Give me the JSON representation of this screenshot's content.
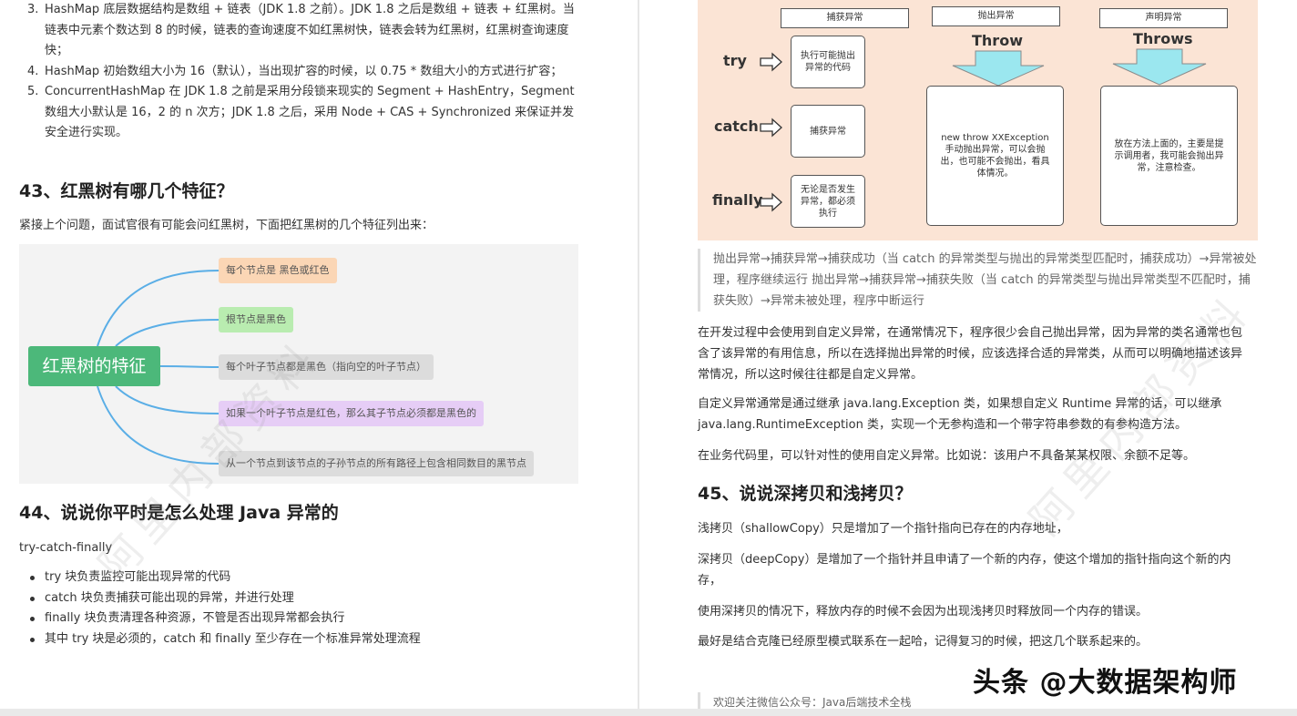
{
  "left": {
    "intro_list": [
      {
        "num": "3.",
        "text": "HashMap 底层数据结构是数组 + 链表（JDK 1.8 之前）。JDK 1.8 之后是数组 + 链表 + 红黑树。当链表中元素个数达到 8 的时候，链表的查询速度不如红黑树快，链表会转为红黑树，红黑树查询速度快；"
      },
      {
        "num": "4.",
        "text": "HashMap 初始数组大小为 16（默认），当出现扩容的时候，以 0.75 * 数组大小的方式进行扩容；"
      },
      {
        "num": "5.",
        "text": "ConcurrentHashMap 在 JDK 1.8 之前是采用分段锁来现实的 Segment + HashEntry，Segment 数组大小默认是 16，2 的 n 次方；JDK 1.8 之后，采用 Node + CAS + Synchronized 来保证并发安全进行实现。"
      }
    ],
    "q43_title": "43、红黑树有哪几个特征？",
    "q43_intro": "紧接上个问题，面试官很有可能会问红黑树，下面把红黑树的几个特征列出来：",
    "mindmap": {
      "root": "红黑树的特征",
      "nodes": [
        {
          "text": "每个节点是 黑色或红色",
          "color": "#fbd6b5"
        },
        {
          "text": "根节点是黑色",
          "color": "#b9ecb0"
        },
        {
          "text": "每个叶子节点都是黑色（指向空的叶子节点）",
          "color": "#dcdcdc"
        },
        {
          "text": "如果一个叶子节点是红色，那么其子节点必须都是黑色的",
          "color": "#e6cdf6"
        },
        {
          "text": "从一个节点到该节点的子孙节点的所有路径上包含相同数目的黑节点",
          "color": "#dcdcdc"
        }
      ]
    },
    "q44_title": "44、说说你平时是怎么处理 Java 异常的",
    "q44_intro": "try-catch-finally",
    "q44_items": [
      "try 块负责监控可能出现异常的代码",
      "catch 块负责捕获可能出现的异常，并进行处理",
      "finally 块负责清理各种资源，不管是否出现异常都会执行",
      "其中 try 块是必须的，catch 和 finally 至少存在一个标准异常处理流程"
    ],
    "watermark": "阿里内部资料"
  },
  "right": {
    "diagram": {
      "header_catch": "捕获异常",
      "header_throw": "抛出异常",
      "header_throws": "声明异常",
      "kw_try": "try",
      "kw_catch": "catch",
      "kw_finally": "finally",
      "kw_throw": "Throw",
      "kw_throws": "Throws",
      "box_try": "执行可能抛出异常的代码",
      "box_catch": "捕获异常",
      "box_finally": "无论是否发生异常，都必须执行",
      "box_throw": "new throw XXException 手动抛出异常，可以会抛出，也可能不会抛出，看具体情况。",
      "box_throws": "放在方法上面的，主要是提示调用者，我可能会抛出异常，注意检查。"
    },
    "quote": "抛出异常→捕获异常→捕获成功（当 catch 的异常类型与抛出的异常类型匹配时，捕获成功）→异常被处理，程序继续运行 抛出异常→捕获异常→捕获失败（当 catch 的异常类型与抛出异常类型不匹配时，捕获失败）→异常未被处理，程序中断运行",
    "p1": "在开发过程中会使用到自定义异常，在通常情况下，程序很少会自己抛出异常，因为异常的类名通常也包含了该异常的有用信息，所以在选择抛出异常的时候，应该选择合适的异常类，从而可以明确地描述该异常情况，所以这时候往往都是自定义异常。",
    "p2": "自定义异常通常是通过继承 java.lang.Exception 类，如果想自定义 Runtime 异常的话，可以继承 java.lang.RuntimeException 类，实现一个无参构造和一个带字符串参数的有参构造方法。",
    "p3": "在业务代码里，可以针对性的使用自定义异常。比如说：该用户不具备某某权限、余额不足等。",
    "q45_title": "45、说说深拷贝和浅拷贝？",
    "q45_p1": "浅拷贝（shallowCopy）只是增加了一个指针指向已存在的内存地址，",
    "q45_p2": "深拷贝（deepCopy）是增加了一个指针并且申请了一个新的内存，使这个增加的指针指向这个新的内存，",
    "q45_p3": "使用深拷贝的情况下，释放内存的时候不会因为出现浅拷贝时释放同一个内存的错误。",
    "q45_p4": "最好是结合克隆已经原型模式联系在一起哈，记得复习的时候，把这几个联系起来的。",
    "footer": "欢迎关注微信公众号：Java后端技术全栈",
    "watermark": "阿里内部资料"
  },
  "overlay": {
    "toutiao": "头条 @大数据架构师"
  }
}
